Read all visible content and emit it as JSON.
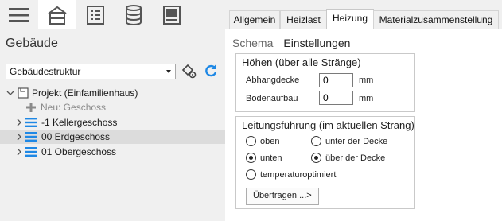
{
  "left": {
    "toolbar": {
      "icons": [
        "menu-icon",
        "building-icon",
        "list-icon",
        "database-icon",
        "report-icon"
      ],
      "active_index": 1
    },
    "title": "Gebäude",
    "structure_select": {
      "value": "Gebäudestruktur"
    },
    "tree": {
      "root": {
        "label": "Projekt (Einfamilienhaus)",
        "expanded": true
      },
      "new_item": {
        "label": "Neu: Geschoss"
      },
      "floors": [
        {
          "label": "-1 Kellergeschoss",
          "selected": false
        },
        {
          "label": "00 Erdgeschoss",
          "selected": true
        },
        {
          "label": "01 Obergeschoss",
          "selected": false
        }
      ]
    }
  },
  "right": {
    "tabs": [
      {
        "label": "Allgemein",
        "active": false
      },
      {
        "label": "Heizlast",
        "active": false
      },
      {
        "label": "Heizung",
        "active": true
      },
      {
        "label": "Materialzusammenstellung",
        "active": false
      }
    ],
    "subtabs": {
      "schema": "Schema",
      "einstellungen": "Einstellungen"
    },
    "heights": {
      "title": "Höhen (über alle Stränge)",
      "abhangdecke": {
        "label": "Abhangdecke",
        "value": "0",
        "unit": "mm"
      },
      "bodenaufbau": {
        "label": "Bodenaufbau",
        "value": "0",
        "unit": "mm"
      }
    },
    "routing": {
      "title": "Leitungsführung (im aktuellen Strang)",
      "options": {
        "oben": {
          "label": "oben",
          "checked": false
        },
        "unter_decke": {
          "label": "unter der Decke",
          "checked": false
        },
        "unten": {
          "label": "unten",
          "checked": true
        },
        "ueber_decke": {
          "label": "über der Decke",
          "checked": true
        },
        "temperaturoptimiert": {
          "label": "temperaturoptimiert",
          "checked": false
        }
      },
      "apply_button": "Übertragen ...>"
    }
  },
  "colors": {
    "accent_blue": "#1e88e5",
    "panel_bg": "#f0f0f0",
    "selected_row": "#dcdcdc",
    "icon_gray": "#5a5a5a"
  }
}
